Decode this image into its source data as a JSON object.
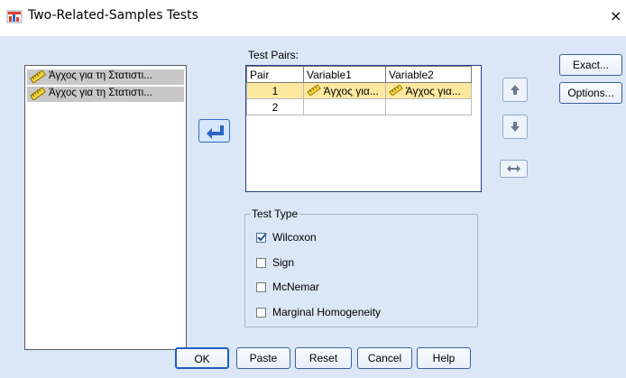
{
  "window": {
    "title": "Two-Related-Samples Tests",
    "close_glyph": "×"
  },
  "source_list": {
    "items": [
      {
        "label": "Άγχος για τη Στατιστι...",
        "icon": "scale-variable-icon"
      },
      {
        "label": "Άγχος για τη Στατιστι...",
        "icon": "scale-variable-icon"
      }
    ]
  },
  "test_pairs": {
    "label": "Test Pairs:",
    "columns": [
      "Pair",
      "Variable1",
      "Variable2"
    ],
    "rows": [
      {
        "pair": "1",
        "var1": "Άγχος για...",
        "var2": "Άγχος για..."
      },
      {
        "pair": "2",
        "var1": "",
        "var2": ""
      }
    ]
  },
  "side_buttons": {
    "exact": "Exact...",
    "options": "Options..."
  },
  "test_type": {
    "legend": "Test Type",
    "options": [
      {
        "label": "Wilcoxon",
        "checked": true
      },
      {
        "label": "Sign",
        "checked": false
      },
      {
        "label": "McNemar",
        "checked": false
      },
      {
        "label": "Marginal Homogeneity",
        "checked": false
      }
    ]
  },
  "footer": {
    "ok": "OK",
    "paste": "Paste",
    "reset": "Reset",
    "cancel": "Cancel",
    "help": "Help"
  },
  "colors": {
    "background": "#dbe7f6",
    "selected_cell": "#fce89f",
    "button_border": "#3a5f9c",
    "check": "#2a4f9a"
  }
}
